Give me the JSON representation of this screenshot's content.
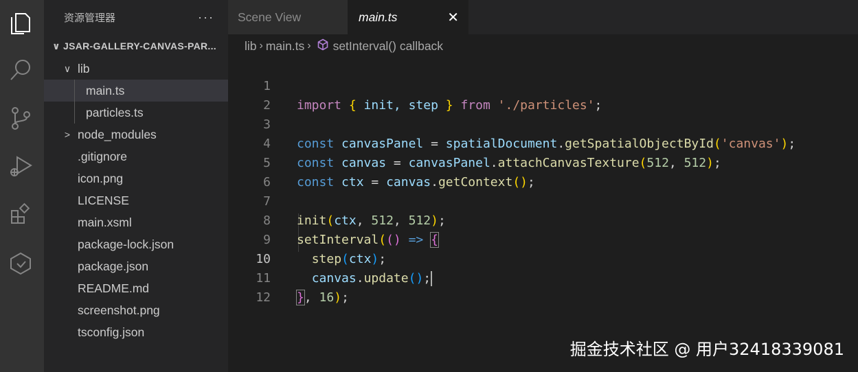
{
  "sidebar": {
    "title": "资源管理器",
    "more": "···",
    "root": "JSAR-GALLERY-CANVAS-PAR...",
    "items": [
      {
        "label": "lib",
        "chevron": "∨"
      },
      {
        "label": "main.ts"
      },
      {
        "label": "particles.ts"
      },
      {
        "label": "node_modules",
        "chevron": ">"
      },
      {
        "label": ".gitignore"
      },
      {
        "label": "icon.png"
      },
      {
        "label": "LICENSE"
      },
      {
        "label": "main.xsml"
      },
      {
        "label": "package-lock.json"
      },
      {
        "label": "package.json"
      },
      {
        "label": "README.md"
      },
      {
        "label": "screenshot.png"
      },
      {
        "label": "tsconfig.json"
      }
    ]
  },
  "tabs": [
    {
      "label": "Scene View"
    },
    {
      "label": "main.ts",
      "close": "✕"
    }
  ],
  "breadcrumb": [
    "lib",
    "main.ts",
    "setInterval() callback"
  ],
  "editor": {
    "line_numbers": [
      "1",
      "2",
      "3",
      "4",
      "5",
      "6",
      "7",
      "8",
      "9",
      "10",
      "11",
      "12"
    ],
    "current_line": "10",
    "t": {
      "import": "import",
      "lb": "{",
      "init_import": " init, step ",
      "rb": "}",
      "from": "from",
      "path": "'./particles'",
      "semi": ";",
      "const": "const",
      "canvasPanel": "canvasPanel",
      "eq": " = ",
      "spatialDocument": "spatialDocument",
      "dot": ".",
      "getSpatialObjectById": "getSpatialObjectById",
      "lp": "(",
      "rp": ")",
      "canvas_str": "'canvas'",
      "canvas": "canvas",
      "attachCanvasTexture": "attachCanvasTexture",
      "n512": "512",
      "comma": ", ",
      "ctx": "ctx",
      "getContext": "getContext",
      "init": "init",
      "setInterval": "setInterval",
      "arrow": "=>",
      "step": "step",
      "update": "update",
      "n16": "16"
    }
  },
  "watermark": "掘金技术社区 @ 用户32418339081"
}
